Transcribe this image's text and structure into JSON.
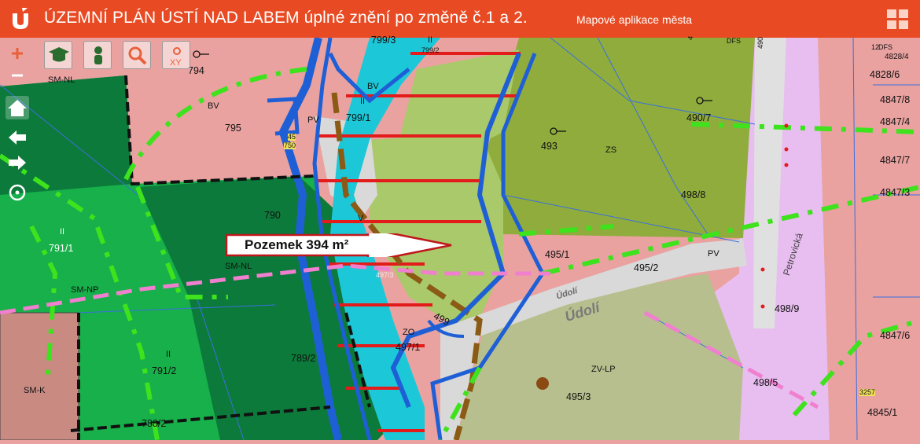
{
  "header": {
    "title": "ÚZEMNÍ PLÁN ÚSTÍ NAD LABEM úplné znění po změně č.1 a 2.",
    "apps_link": "Mapové aplikace města"
  },
  "colors": {
    "header_bg": "#e84b23",
    "zone_pink": "#e9a2a0",
    "zone_green_dark": "#0c7a3a",
    "zone_green": "#17b04a",
    "zone_olive": "#8fac3c",
    "zone_lightgreen": "#a9c96a",
    "water": "#1cc7d8",
    "boundary_blue": "#1f5fd6",
    "road_gray": "#d9d9d9",
    "lilac": "#e8bdf0",
    "corridor_green": "#3ee21d",
    "hatch_red": "#e31b1b"
  },
  "tools": [
    {
      "icon": "zoom-in-icon",
      "glyph": "+"
    },
    {
      "icon": "zoom-out-icon",
      "glyph": "−"
    },
    {
      "icon": "home-icon"
    },
    {
      "icon": "back-icon"
    },
    {
      "icon": "forward-icon"
    },
    {
      "icon": "locate-icon"
    },
    {
      "icon": "legend-icon"
    },
    {
      "icon": "person-icon"
    },
    {
      "icon": "search-icon"
    },
    {
      "icon": "coordinates-icon",
      "glyph": "XY"
    }
  ],
  "callout": {
    "text": "Pozemek 394 m²"
  },
  "streets": {
    "udoli": "Údolí",
    "udoli_small": "Údolí",
    "petrovicka": "Petrovická"
  },
  "labels": {
    "l794": "794",
    "l795": "795",
    "l799_1": "799/1",
    "l799_3": "799/3",
    "l799_2": "799/2",
    "l790": "790",
    "l791_1": "791/1",
    "l791_2": "791/2",
    "l789_2": "789/2",
    "l788_2": "788/2",
    "l493": "493",
    "l490_7": "490/7",
    "l498_8": "498/8",
    "l495_1": "495/1",
    "l495_2": "495/2",
    "l495_3": "495/3",
    "l497_1": "497/1",
    "l497_3": "497/3",
    "l499": "499",
    "l498_9": "498/9",
    "l498_5": "498/5",
    "l4828_6": "4828/6",
    "l4847_8": "4847/8",
    "l4847_4": "4847/4",
    "l4847_7": "4847/7",
    "l4847_3": "4847/3",
    "l4847_6": "4847/6",
    "l4845_1": "4845/1",
    "l4828_4": "4828/4",
    "l3257": "3257",
    "smnl1": "SM-NL",
    "smnl2": "SM-NL",
    "smnp": "SM-NP",
    "smk": "SM-K",
    "bv1": "BV",
    "bv2": "BV",
    "pv1": "PV",
    "pv2": "PV",
    "zs": "ZS",
    "zvlp": "ZV-LP",
    "zo": "ZO",
    "v": "V",
    "ii1": "II",
    "ii2": "II",
    "ii3": "II",
    "ii4": "II",
    "dfs": "DFS",
    "n45": "45",
    "n750": "750",
    "n4": "4",
    "n490": "490",
    "n12": "12"
  }
}
